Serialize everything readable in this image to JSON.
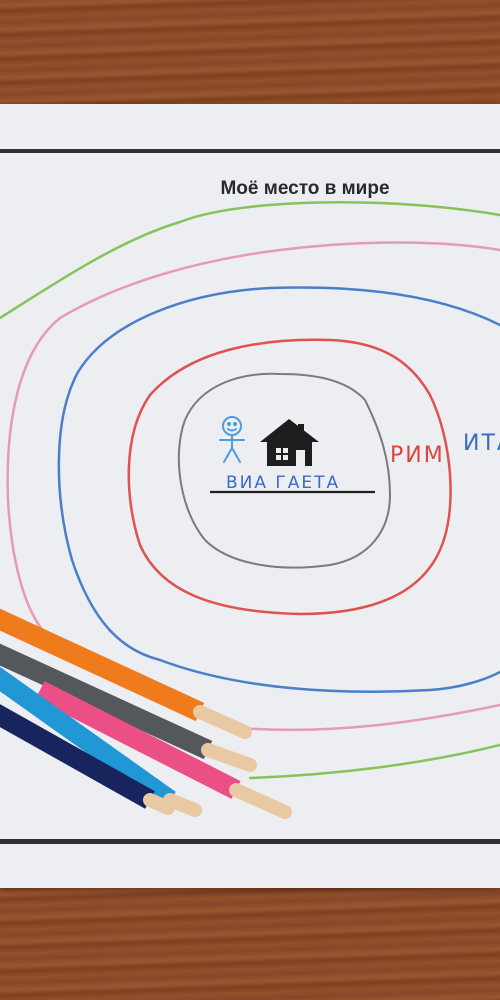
{
  "title": "Моё место в мире",
  "street_label": "ВИА ГАЕТА",
  "city_label": "РИМ",
  "country_label": "ИТА",
  "colors": {
    "green_ring": "#86c45a",
    "pink_ring": "#e79ab4",
    "blue_ring": "#4c7fc9",
    "red_ring": "#e0514f",
    "gray_ring": "#7b7b7b",
    "street_text": "#3a6bc2",
    "city_text": "#d9443f",
    "country_text": "#3a6bc2",
    "person": "#4f9be0",
    "house": "#1e1e1e"
  },
  "pencils": [
    {
      "name": "orange-pencil",
      "color": "#f07b1d"
    },
    {
      "name": "gray-pencil",
      "color": "#54575c"
    },
    {
      "name": "pink-pencil",
      "color": "#ea4f86"
    },
    {
      "name": "light-blue-pencil",
      "color": "#2197d6"
    },
    {
      "name": "navy-pencil",
      "color": "#18245e"
    }
  ]
}
